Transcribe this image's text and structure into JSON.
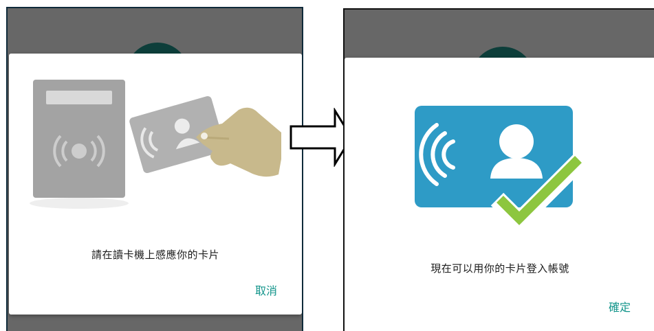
{
  "left_screen": {
    "message": "請在讀卡機上感應你的卡片",
    "cancel_label": "取消"
  },
  "right_screen": {
    "message": "現在可以用你的卡片登入帳號",
    "confirm_label": "確定"
  },
  "colors": {
    "accent": "#11948a",
    "card_blue": "#2e9bc6",
    "check_green": "#8dc63f",
    "overlay": "#676767"
  },
  "icons": [
    "card-reader-icon",
    "hand-holding-card-icon",
    "contactless-card-icon",
    "checkmark-icon",
    "right-arrow-icon"
  ]
}
